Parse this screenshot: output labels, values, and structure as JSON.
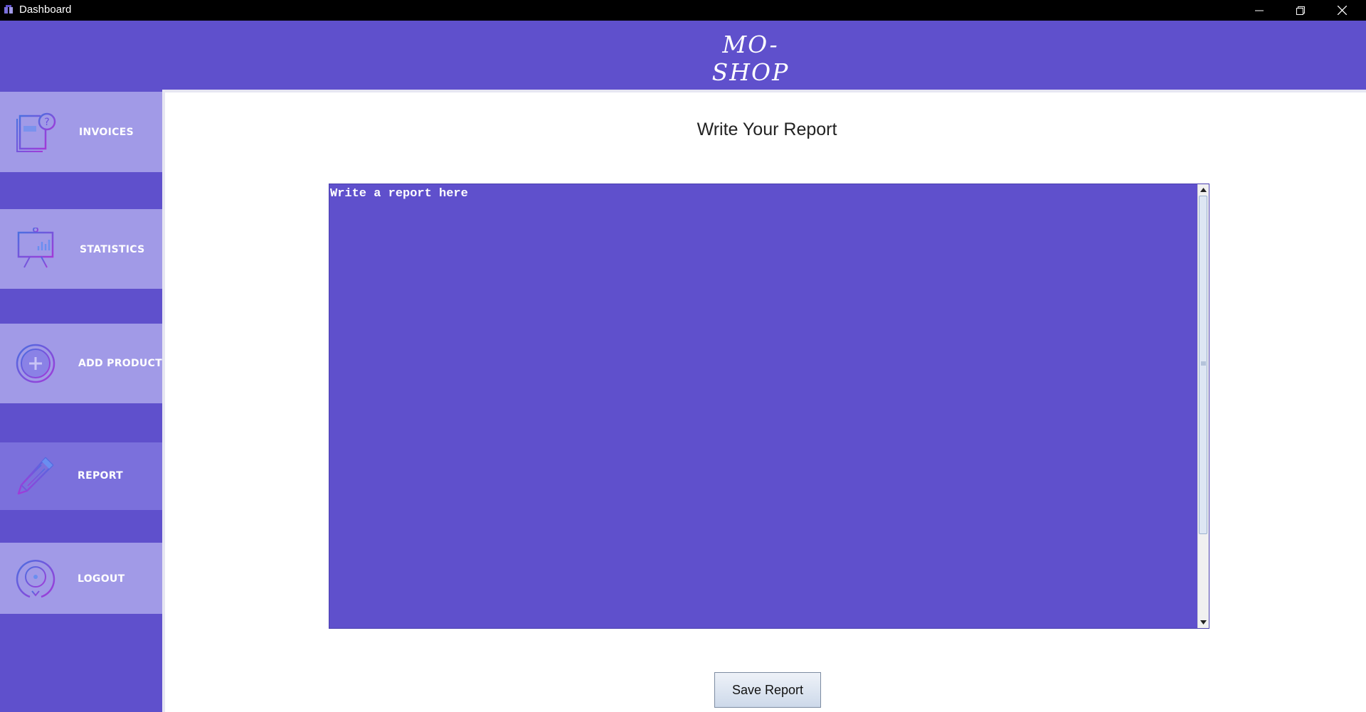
{
  "window": {
    "title": "Dashboard",
    "controls": [
      "minimize-icon",
      "restore-icon",
      "close-icon"
    ]
  },
  "header": {
    "brand": "MO-SHOP"
  },
  "sidebar": {
    "items": [
      {
        "label": "INVOICES",
        "icon": "invoice-icon",
        "active": false
      },
      {
        "label": "STATISTICS",
        "icon": "presentation-chart-icon",
        "active": false
      },
      {
        "label": "ADD PRODUCT",
        "icon": "plus-circle-icon",
        "active": false
      },
      {
        "label": "REPORT",
        "icon": "pencil-icon",
        "active": true
      },
      {
        "label": "LOGOUT",
        "icon": "logout-icon",
        "active": false
      }
    ]
  },
  "main": {
    "title": "Write Your Report",
    "report": {
      "placeholder": "Write a report here",
      "value": ""
    },
    "save_label": "Save Report"
  },
  "colors": {
    "accent": "#5f50cc",
    "sidebar_item": "#a19ae7",
    "sidebar_item_active": "#7b70dc",
    "titlebar": "#000000",
    "content_background": "#ffffff"
  }
}
